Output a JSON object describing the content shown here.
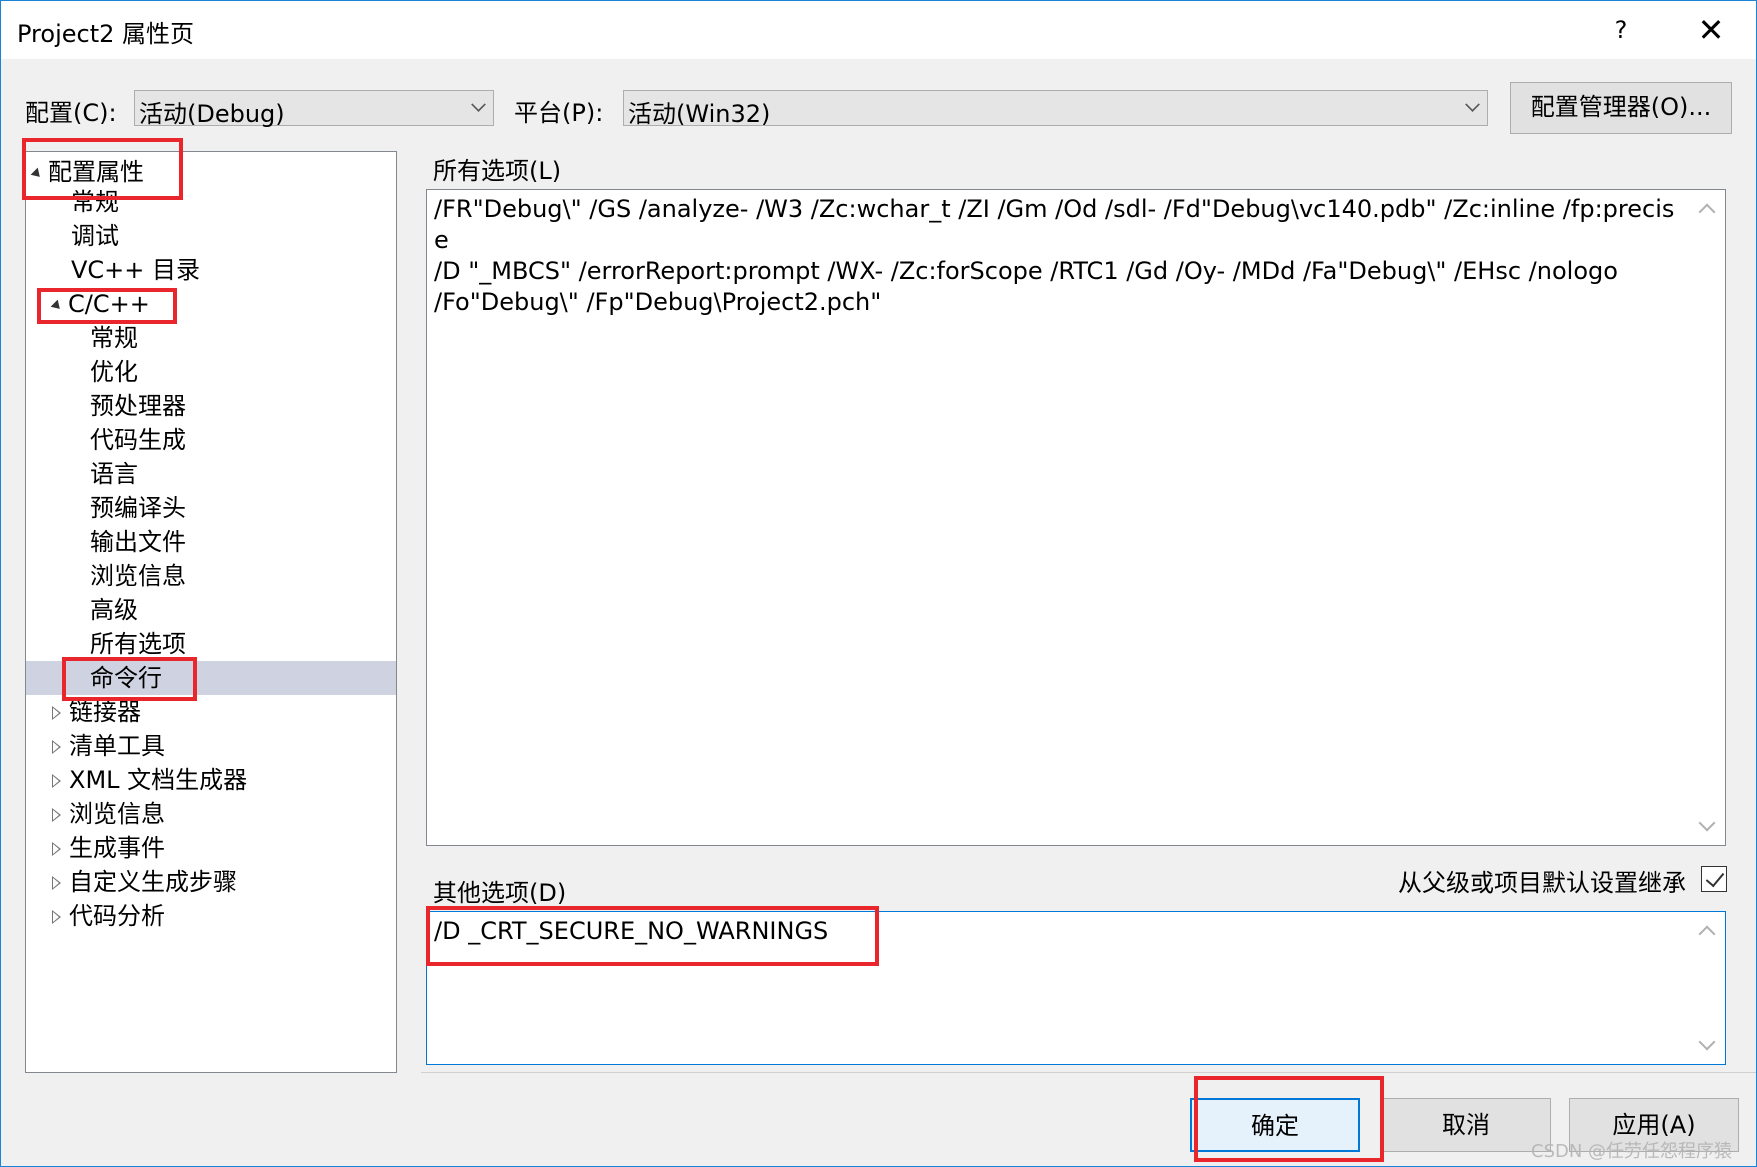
{
  "window": {
    "title": "Project2 属性页",
    "help": "?",
    "close": "✕"
  },
  "toolbar": {
    "config_label": "配置(C):",
    "config_value": "活动(Debug)",
    "platform_label": "平台(P):",
    "platform_value": "活动(Win32)",
    "config_manager": "配置管理器(O)..."
  },
  "tree": {
    "root": "配置属性",
    "items": [
      "常规",
      "调试",
      "VC++ 目录",
      "C/C++",
      "常规",
      "优化",
      "预处理器",
      "代码生成",
      "语言",
      "预编译头",
      "输出文件",
      "浏览信息",
      "高级",
      "所有选项",
      "命令行",
      "链接器",
      "清单工具",
      "XML 文档生成器",
      "浏览信息",
      "生成事件",
      "自定义生成步骤",
      "代码分析"
    ]
  },
  "all_options": {
    "label": "所有选项(L)",
    "text": "/FR\"Debug\\\" /GS /analyze- /W3 /Zc:wchar_t /ZI /Gm /Od /sdl- /Fd\"Debug\\vc140.pdb\" /Zc:inline /fp:precise\n/D \"_MBCS\" /errorReport:prompt /WX- /Zc:forScope /RTC1 /Gd /Oy- /MDd /Fa\"Debug\\\" /EHsc /nologo\n/Fo\"Debug\\\" /Fp\"Debug\\Project2.pch\""
  },
  "other_options": {
    "label": "其他选项(D)",
    "inherit_label": "从父级或项目默认设置继承",
    "inherit_checked": true,
    "text": "/D _CRT_SECURE_NO_WARNINGS"
  },
  "buttons": {
    "ok": "确定",
    "cancel": "取消",
    "apply": "应用(A)"
  },
  "watermark": "CSDN @任劳任怨程序猿",
  "colors": {
    "highlight": "#e8262b",
    "accent": "#0078d7",
    "selection": "#cfd2e0"
  }
}
